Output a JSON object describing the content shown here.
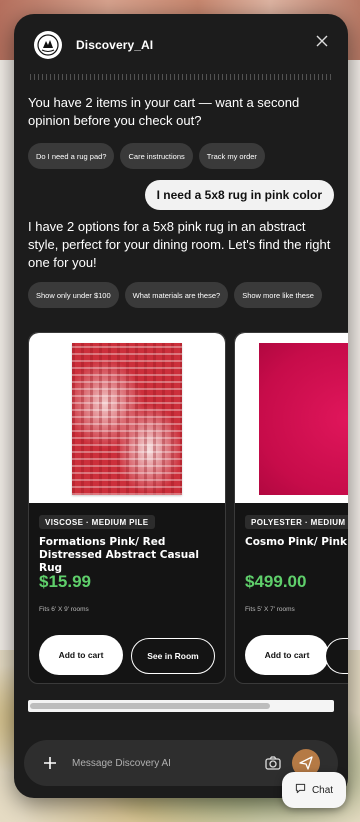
{
  "header": {
    "title": "Discovery_AI"
  },
  "messages": {
    "bot_1": "You have 2 items in your cart — want a second opinion before you check out?",
    "user_1": "I need a 5x8 rug in pink color",
    "bot_2": "I have 2 options for a 5x8 pink rug in an abstract style, perfect for your dining room. Let's find the right one for you!"
  },
  "chips_1": [
    "Do I need a rug pad?",
    "Care instructions",
    "Track my order"
  ],
  "chips_2": [
    "Show only under $100",
    "What materials are these?",
    "Show more like these"
  ],
  "products": [
    {
      "material": "VISCOSE · MEDIUM PILE",
      "name": "Formations Pink/ Red Distressed Abstract Casual Rug",
      "price": "$15.99",
      "fits": "Fits 6' X 9' rooms",
      "cart_label": "Add to cart",
      "room_label": "See in Room"
    },
    {
      "material": "POLYESTER · MEDIUM",
      "name": "Cosmo Pink/ Pink S",
      "price": "$499.00",
      "fits": "Fits 5' X 7' rooms",
      "cart_label": "Add to cart"
    }
  ],
  "input": {
    "placeholder": "Message Discovery AI"
  },
  "chat_button": {
    "label": "Chat"
  },
  "colors": {
    "panel": "#1c1c1c",
    "price": "#5fcf6b",
    "send": "#b57a45"
  },
  "icons": [
    "close-icon",
    "plus-icon",
    "camera-icon",
    "send-icon",
    "chat-icon",
    "brand-logo"
  ]
}
